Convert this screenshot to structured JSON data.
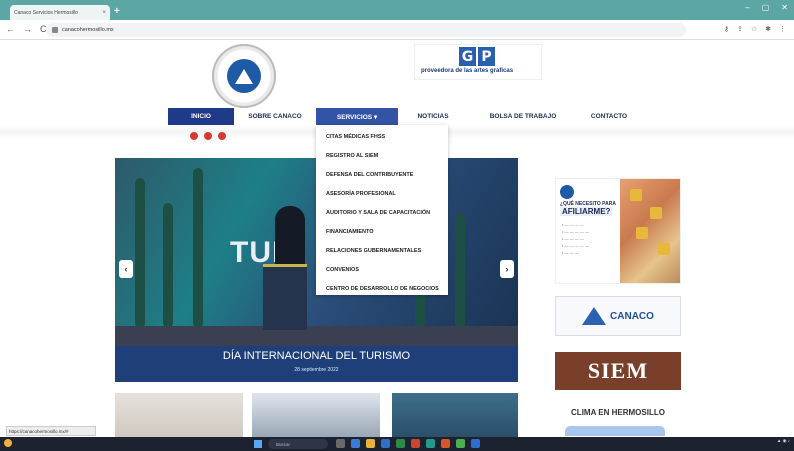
{
  "browser": {
    "tab_title": "Canaco Servicios Hermosillo",
    "tab_close": "×",
    "new_tab": "+",
    "window_controls": [
      "–",
      "▢",
      "✕"
    ],
    "nav": [
      "←",
      "→",
      "C"
    ],
    "url": "canacohermosillo.mx"
  },
  "header": {
    "sponsor_letters": [
      "G",
      "P"
    ],
    "sponsor_text": "proveedora de las artes graficas"
  },
  "nav": {
    "items": [
      {
        "label": "INICIO"
      },
      {
        "label": "SOBRE CANACO"
      },
      {
        "label": "SERVICIOS ▾"
      },
      {
        "label": "NOTICIAS"
      },
      {
        "label": "BOLSA DE TRABAJO"
      },
      {
        "label": "CONTACTO"
      }
    ]
  },
  "dropdown": {
    "items": [
      "CITAS MÉDICAS FHSS",
      "REGISTRO AL SIEM",
      "DEFENSA DEL CONTRIBUYENTE",
      "ASESORÍA PROFESIONAL",
      "AUDITORIO Y SALA DE CAPACITACIÓN",
      "FINANCIAMIENTO",
      "RELACIONES GUBERNAMENTALES",
      "CONVENIOS",
      "CENTRO DE DESARROLLO DE NEGOCIOS"
    ]
  },
  "slider": {
    "title": "DÍA INTERNACIONAL DEL TURISMO",
    "date": "28 septiembre 2022",
    "big_text": "TUR",
    "prev": "‹",
    "next": "›"
  },
  "sidebar": {
    "afiliate_ask": "¿QUÉ NECESITO PARA",
    "afiliate_big": "AFILIARME?",
    "negocios": "CANACO",
    "siem": "SIEM",
    "clima": "CLIMA EN HERMOSILLO"
  },
  "status_url": "https://canacohermosillo.mx/#",
  "taskbar": {
    "search": "Buscar"
  }
}
